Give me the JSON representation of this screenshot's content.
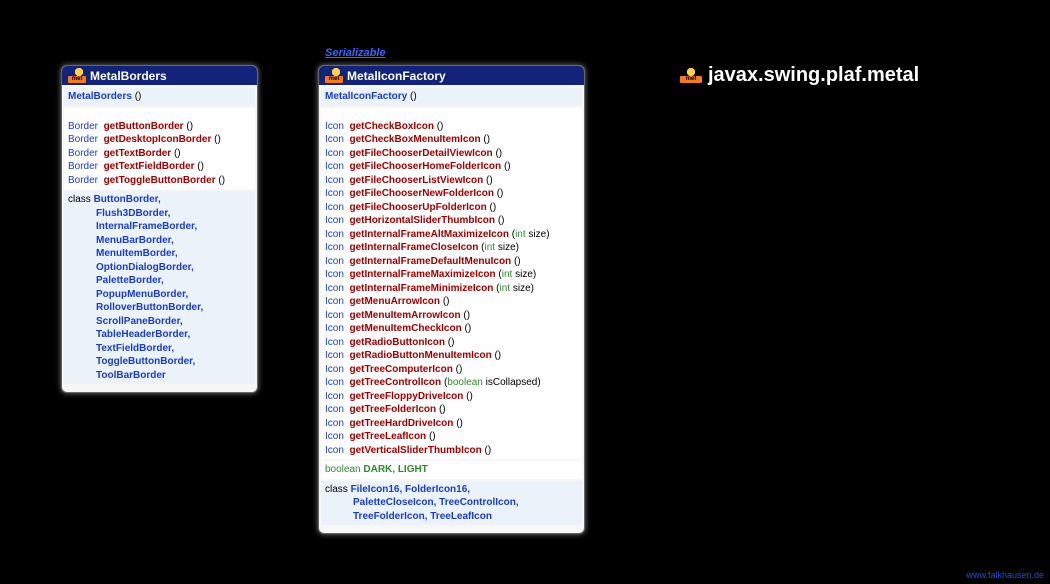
{
  "implements_label": "Serializable",
  "package": {
    "icon_label": "met",
    "name": "javax.swing.plaf.metal"
  },
  "credit": "www.falkhausen.de",
  "box1": {
    "title": "MetalBorders",
    "ctor": "MetalBorders",
    "methods": [
      {
        "ret": "Border",
        "name": "getButtonBorder"
      },
      {
        "ret": "Border",
        "name": "getDesktopIconBorder"
      },
      {
        "ret": "Border",
        "name": "getTextBorder"
      },
      {
        "ret": "Border",
        "name": "getTextFieldBorder"
      },
      {
        "ret": "Border",
        "name": "getToggleButtonBorder"
      }
    ],
    "inner_kw": "class",
    "inner": [
      "ButtonBorder,",
      "Flush3DBorder,",
      "InternalFrameBorder,",
      "MenuBarBorder,",
      "MenuItemBorder,",
      "OptionDialogBorder,",
      "PaletteBorder,",
      "PopupMenuBorder,",
      "RolloverButtonBorder,",
      "ScrollPaneBorder,",
      "TableHeaderBorder,",
      "TextFieldBorder,",
      "ToggleButtonBorder,",
      "ToolBarBorder"
    ]
  },
  "box2": {
    "title": "MetalIconFactory",
    "ctor": "MetalIconFactory",
    "methods": [
      {
        "ret": "Icon",
        "name": "getCheckBoxIcon",
        "params": ""
      },
      {
        "ret": "Icon",
        "name": "getCheckBoxMenuItemIcon",
        "params": ""
      },
      {
        "ret": "Icon",
        "name": "getFileChooserDetailViewIcon",
        "params": ""
      },
      {
        "ret": "Icon",
        "name": "getFileChooserHomeFolderIcon",
        "params": ""
      },
      {
        "ret": "Icon",
        "name": "getFileChooserListViewIcon",
        "params": ""
      },
      {
        "ret": "Icon",
        "name": "getFileChooserNewFolderIcon",
        "params": ""
      },
      {
        "ret": "Icon",
        "name": "getFileChooserUpFolderIcon",
        "params": ""
      },
      {
        "ret": "Icon",
        "name": "getHorizontalSliderThumbIcon",
        "params": ""
      },
      {
        "ret": "Icon",
        "name": "getInternalFrameAltMaximizeIcon",
        "params": "int size"
      },
      {
        "ret": "Icon",
        "name": "getInternalFrameCloseIcon",
        "params": "int size"
      },
      {
        "ret": "Icon",
        "name": "getInternalFrameDefaultMenuIcon",
        "params": ""
      },
      {
        "ret": "Icon",
        "name": "getInternalFrameMaximizeIcon",
        "params": "int size"
      },
      {
        "ret": "Icon",
        "name": "getInternalFrameMinimizeIcon",
        "params": "int size"
      },
      {
        "ret": "Icon",
        "name": "getMenuArrowIcon",
        "params": ""
      },
      {
        "ret": "Icon",
        "name": "getMenuItemArrowIcon",
        "params": ""
      },
      {
        "ret": "Icon",
        "name": "getMenuItemCheckIcon",
        "params": ""
      },
      {
        "ret": "Icon",
        "name": "getRadioButtonIcon",
        "params": ""
      },
      {
        "ret": "Icon",
        "name": "getRadioButtonMenuItemIcon",
        "params": ""
      },
      {
        "ret": "Icon",
        "name": "getTreeComputerIcon",
        "params": ""
      },
      {
        "ret": "Icon",
        "name": "getTreeControlIcon",
        "params": "boolean isCollapsed"
      },
      {
        "ret": "Icon",
        "name": "getTreeFloppyDriveIcon",
        "params": ""
      },
      {
        "ret": "Icon",
        "name": "getTreeFolderIcon",
        "params": ""
      },
      {
        "ret": "Icon",
        "name": "getTreeHardDriveIcon",
        "params": ""
      },
      {
        "ret": "Icon",
        "name": "getTreeLeafIcon",
        "params": ""
      },
      {
        "ret": "Icon",
        "name": "getVerticalSliderThumbIcon",
        "params": ""
      }
    ],
    "field_kw": "boolean",
    "fields": "DARK, LIGHT",
    "inner_kw": "class",
    "inner_lines": [
      "FileIcon16, FolderIcon16,",
      "PaletteCloseIcon, TreeControlIcon,",
      "TreeFolderIcon, TreeLeafIcon"
    ]
  }
}
